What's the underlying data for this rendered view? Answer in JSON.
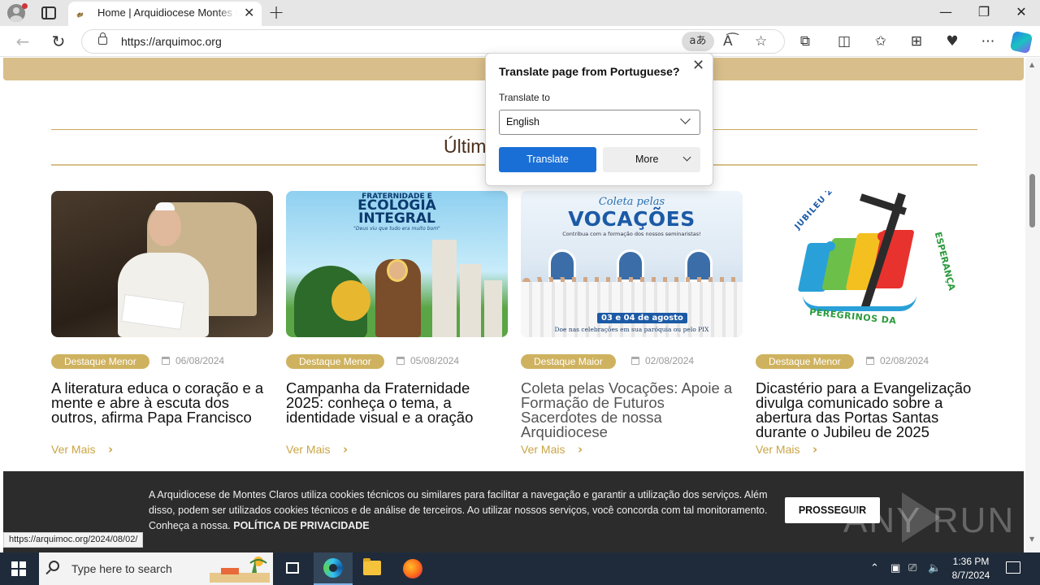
{
  "browser": {
    "tab_title": "Home | Arquidiocese Montes Claros",
    "url": "https://arquimoc.org",
    "translate_icon": "aあ",
    "new_tab_symbol": "+",
    "close_symbol": "✕",
    "status_url": "https://arquimoc.org/2024/08/02/",
    "icons": [
      "back-icon",
      "refresh-icon",
      "lock-icon",
      "translate-icon",
      "read-aloud-icon",
      "favorite-star-icon",
      "extensions-icon",
      "split-screen-icon",
      "favorites-icon",
      "collections-icon",
      "performance-icon",
      "more-icon",
      "copilot-icon"
    ]
  },
  "translate_popup": {
    "title": "Translate page from Portuguese?",
    "label": "Translate to",
    "selected_language": "English",
    "translate_button": "Translate",
    "more_button": "More"
  },
  "section": {
    "title": "Últim"
  },
  "posts": [
    {
      "badge": "Destaque Menor",
      "date": "06/08/2024",
      "title": "A literatura educa o coração e a mente e abre à escuta dos outros, afirma Papa Francisco",
      "more": "Ver Mais"
    },
    {
      "badge": "Destaque Menor",
      "date": "05/08/2024",
      "title": "Campanha da Fraternidade 2025: conheça o tema, a identidade visual e a oração",
      "more": "Ver Mais",
      "image_text": {
        "top": "FRATERNIDADE E",
        "big1": "ECOLOGIA",
        "big2": "INTEGRAL",
        "quote": "\"Deus viu que tudo era muito bom\""
      }
    },
    {
      "badge": "Destaque Maior",
      "date": "02/08/2024",
      "title": "Coleta pelas Vocações: Apoie a Formação de Futuros Sacerdotes de nossa Arquidiocese",
      "more": "Ver Mais",
      "image_text": {
        "small": "Coleta pelas",
        "big": "VOCAÇÕES",
        "sub": "Contribua com a formação dos nossos seminaristas!",
        "date_tag": "03 e 04 de agosto",
        "footer": "Doe nas celebrações em sua paróquia ou pelo PIX"
      }
    },
    {
      "badge": "Destaque Menor",
      "date": "02/08/2024",
      "title": "Dicastério para a Evangelização divulga comunicado sobre a abertura das Portas Santas durante o Jubileu de 2025",
      "more": "Ver Mais",
      "image_text": {
        "top": "JUBILEU 2025",
        "bottom": "PEREGRINOS DA",
        "right": "ESPERANÇA"
      }
    }
  ],
  "cookie": {
    "text": "A Arquidiocese de Montes Claros utiliza cookies técnicos ou similares para facilitar a navegação e garantir a utilização dos serviços. Além disso, podem ser utilizados cookies técnicos e de análise de terceiros. Ao utilizar nossos serviços, você concorda com tal monitoramento. Conheça a nossa.",
    "policy_link": "POLÍTICA DE PRIVACIDADE",
    "button": "PROSSEGUIR",
    "watermark": "ANY  RUN"
  },
  "taskbar": {
    "search_placeholder": "Type here to search",
    "time": "1:36 PM",
    "date": "8/7/2024"
  },
  "colors": {
    "gold": "#cfb25f",
    "gold_band": "#d8be8a",
    "link_gold": "#c9a545",
    "translate_blue": "#1a6fd6"
  }
}
